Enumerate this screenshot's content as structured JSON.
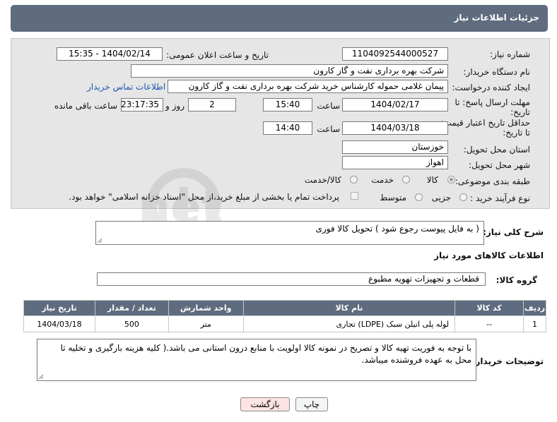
{
  "header": {
    "title": "جزئیات اطلاعات نیاز"
  },
  "form": {
    "need_number_label": "شماره نیاز:",
    "need_number": "1104092544000527",
    "announce_label": "تاریخ و ساعت اعلان عمومی:",
    "announce_value": "1404/02/14 - 15:35",
    "buyer_org_label": "نام دستگاه خریدار:",
    "buyer_org": "شرکت بهره برداری نفت و گاز کارون",
    "creator_label": "ایجاد کننده درخواست:",
    "creator": "پیمان غلامی حموله کارشناس خرید شرکت بهره برداری نفت و گاز کارون",
    "contact_link": "اطلاعات تماس خریدار",
    "deadline_label_1": "مهلت ارسال پاسخ: تا",
    "deadline_label_2": "تاریخ:",
    "deadline_date": "1404/02/17",
    "time_label": "ساعت",
    "deadline_time": "15:40",
    "days_value": "2",
    "days_label": "روز و",
    "remaining_time": "23:17:35",
    "remaining_label": "ساعت باقی مانده",
    "min_validity_label_1": "حداقل تاریخ اعتبار قیمت:",
    "min_validity_label_2": "تا تاریخ:",
    "validity_date": "1404/03/18",
    "validity_time_label": "ساعت",
    "validity_time": "14:40",
    "province_label": "استان محل تحویل:",
    "province": "خوزستان",
    "city_label": "شهر محل تحویل:",
    "city": "اهواز",
    "category_label": "طبقه بندی موضوعی:",
    "category_options": [
      "کالا",
      "خدمت",
      "کالا/خدمت"
    ],
    "category_selected": "کالا",
    "process_label": "نوع فرآیند خرید :",
    "process_options": [
      "جزیی",
      "متوسط"
    ],
    "payment_note": "پرداخت تمام یا بخشی از مبلغ خرید،از محل \"اسناد خزانه اسلامی\" خواهد بود."
  },
  "description": {
    "label": "شرح کلی نیاز:",
    "value": "( به فایل پیوست رجوع شود ) تحویل کالا فوری"
  },
  "goods_section": {
    "title": "اطلاعات کالاهای مورد نیاز",
    "group_label": "گروه کالا:",
    "group_value": "قطعات و تجهیزات تهویه مطبوع"
  },
  "table": {
    "headers": [
      "ردیف",
      "کد کالا",
      "نام کالا",
      "واحد شمارش",
      "تعداد / مقدار",
      "تاریخ نیاز"
    ],
    "rows": [
      [
        "1",
        "--",
        "لوله پلی اتیلن سبک (LDPE) تجاری",
        "متر",
        "500",
        "1404/03/18"
      ]
    ]
  },
  "notes": {
    "label": "توضیحات خریدار:",
    "value": "با توجه به فوریت تهیه کالا و تصریح در نمونه کالا اولویت با منابع درون استانی می باشد.( کلیه هزینه بارگیری و تخلیه تا محل به عهده فروشنده میباشد."
  },
  "buttons": {
    "print": "چاپ",
    "back": "بازگشت"
  },
  "watermark": {
    "text": "AriaTender.net"
  },
  "colors": {
    "header_bg": "#5f6b7e",
    "panel_bg": "#e6e6e6",
    "link": "#1f55b5",
    "back_button_bg": "#fde3e3"
  }
}
